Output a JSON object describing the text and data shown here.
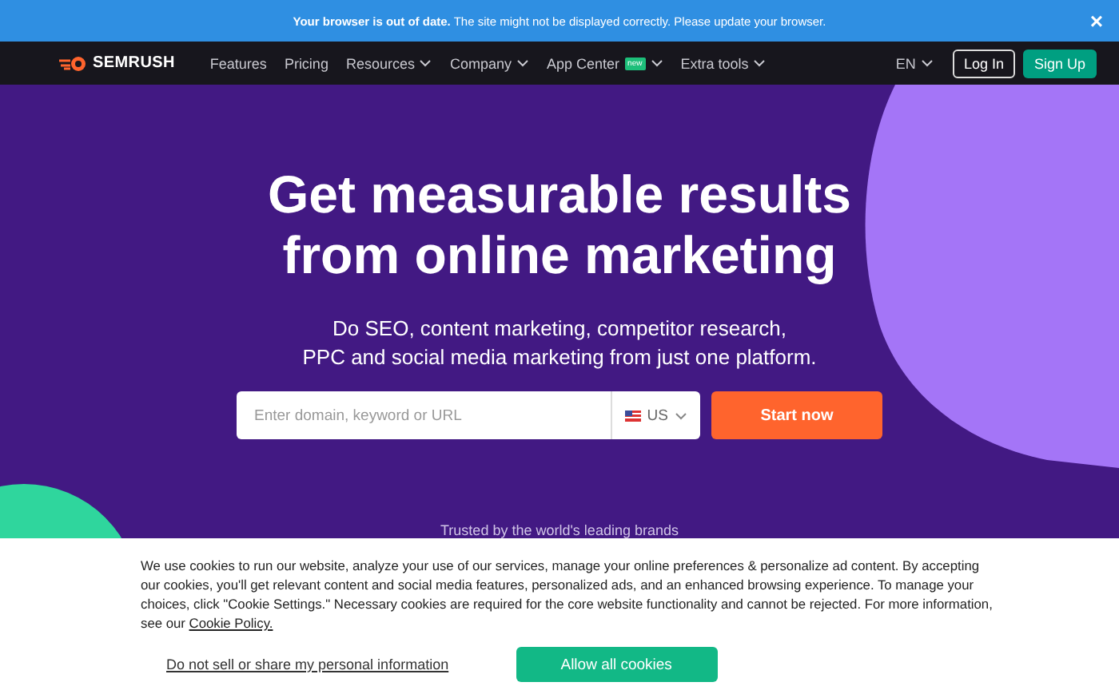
{
  "alert_bar": {
    "message": "**Your browser is out of date.** The site might not be displayed correctly. Please update your browser.",
    "close": "×"
  },
  "nav": {
    "logo": "SEMRUSH",
    "items": [
      {
        "label": "Features",
        "dropdown": false
      },
      {
        "label": "Pricing",
        "dropdown": false
      },
      {
        "label": "Resources",
        "dropdown": true
      },
      {
        "label": "Company",
        "dropdown": true
      },
      {
        "label": "App Center",
        "badge": "new",
        "dropdown": true
      },
      {
        "label": "Extra tools",
        "dropdown": true
      }
    ],
    "language": "EN",
    "login": "Log In",
    "signup": "Sign Up"
  },
  "hero": {
    "title_lines": [
      "Get measurable results",
      "from online marketing"
    ],
    "subtitle_lines": [
      "Do SEO, content marketing, competitor research,",
      "PPC and social media marketing from just one platform."
    ],
    "search": {
      "placeholder": "Enter domain, keyword or URL",
      "country": "US"
    },
    "cta": "Start now",
    "trusted": "Trusted by the world's leading brands"
  },
  "cookie_banner": {
    "text": "We use cookies to run our website, analyze your use of our services, manage your online preferences & personalize ad content. By accepting our cookies, you'll get relevant content and social media features, personalized ads, and an enhanced browsing experience. To manage your choices, click \"Cookie Settings.\" Necessary cookies are required for the core website functionality and cannot be rejected. For more information, see our",
    "policy_link": "Cookie Policy.",
    "optout": "Do not sell or share my personal information",
    "accept": "Allow all cookies"
  }
}
